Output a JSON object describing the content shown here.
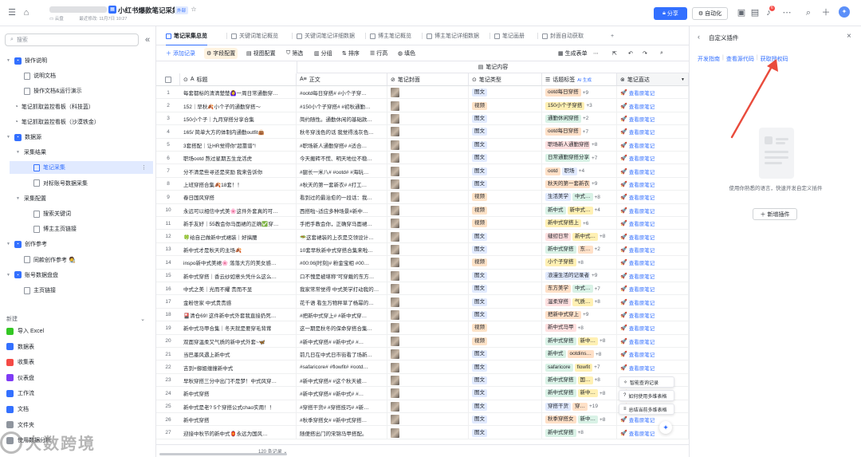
{
  "topbar": {
    "title": "小红书爆款笔记采集",
    "external_badge": "外部",
    "location": "云盘",
    "last_modified": "最近修改: 11月7日 10:27",
    "share_label": "分享",
    "automation_label": "自动化",
    "notification_count": "6"
  },
  "sidebar": {
    "search_placeholder": "搜索",
    "tree": [
      {
        "label": "操作说明",
        "level": 0,
        "kind": "folder",
        "color": "#3370ff",
        "expanded": true
      },
      {
        "label": "说明文档",
        "level": 1,
        "kind": "doc"
      },
      {
        "label": "操作文档&运行演示",
        "level": 1,
        "kind": "doc"
      },
      {
        "label": "笔记抓取监控看板（科技蓝）",
        "level": 0,
        "kind": "dash"
      },
      {
        "label": "笔记抓取监控看板（沙漠铁金）",
        "level": 0,
        "kind": "dash"
      },
      {
        "label": "数据源",
        "level": 0,
        "kind": "folder",
        "color": "#3370ff",
        "expanded": true
      },
      {
        "label": "采集结果",
        "level": 1,
        "kind": "group",
        "expanded": true
      },
      {
        "label": "笔记采集",
        "level": 2,
        "kind": "grid",
        "selected": true
      },
      {
        "label": "对标账号数据采集",
        "level": 2,
        "kind": "grid"
      },
      {
        "label": "采集配置",
        "level": 1,
        "kind": "group",
        "expanded": true
      },
      {
        "label": "搜索关键词",
        "level": 2,
        "kind": "grid"
      },
      {
        "label": "博主主页链接",
        "level": 2,
        "kind": "grid"
      },
      {
        "label": "创作参考",
        "level": 0,
        "kind": "folder",
        "color": "#3370ff",
        "expanded": true
      },
      {
        "label": "同款创作参考 🧑‍🎨",
        "level": 1,
        "kind": "doc"
      },
      {
        "label": "账号数据盘盘",
        "level": 0,
        "kind": "folder",
        "color": "#3370ff",
        "expanded": true
      },
      {
        "label": "主页链接",
        "level": 1,
        "kind": "doc"
      }
    ],
    "new_heading": "新建",
    "new_items": [
      {
        "label": "导入 Excel",
        "color": "#34c724"
      },
      {
        "label": "数据表",
        "color": "#3370ff"
      },
      {
        "label": "收集表",
        "color": "#f54a45"
      },
      {
        "label": "仪表盘",
        "color": "#7f3bf5"
      },
      {
        "label": "工作流",
        "color": "#3370ff"
      },
      {
        "label": "文档",
        "color": "#3370ff"
      },
      {
        "label": "文件夹",
        "color": "#8f959e"
      },
      {
        "label": "使用数据分析",
        "color": "#8f959e"
      }
    ]
  },
  "tabs": [
    "笔记采集总览",
    "关键词笔记概览",
    "关键词笔记详细数据",
    "博主笔记概览",
    "博主笔记详细数据",
    "笔记画册",
    "封面自动获取"
  ],
  "toolbar": {
    "add": "添加记录",
    "field_config": "字段配置",
    "view_config": "视图配置",
    "filter": "筛选",
    "group": "分组",
    "sort": "排序",
    "row_height": "行高",
    "fill": "填色",
    "gen_form": "生成表单"
  },
  "grid": {
    "group_header": "笔记内容",
    "columns": {
      "title": "标题",
      "body": "正文",
      "cover": "笔记封面",
      "type": "笔记类型",
      "tags": "话题标签",
      "tags_ai": "AI 生成",
      "link": "笔记直达"
    },
    "link_text": "查看原笔记",
    "rows": [
      {
        "n": "1",
        "title": "每套都标的清清楚楚🙆‍♀️一周日常通勤穿…",
        "body": "#ootd每日穿搭# #小个子穿…",
        "type": "图文",
        "tags": [
          {
            "t": "ootd每日穿搭",
            "c": "#ffe0c7"
          }
        ],
        "more": "+9"
      },
      {
        "n": "2",
        "title": "152｜早秋🍂小个子的通勤穿搭～",
        "body": "#150小个子穿搭# #初秋通勤…",
        "type": "视频",
        "tags": [
          {
            "t": "150小个子穿搭",
            "c": "#fff0b3"
          }
        ],
        "more": "+3"
      },
      {
        "n": "3",
        "title": "150小个子｜九月穿搭分享合集",
        "body": "简约随性。通勤休闲的基础款…",
        "type": "图文",
        "tags": [
          {
            "t": "通勤休闲穿搭",
            "c": "#d9f2e6"
          }
        ],
        "more": "+2"
      },
      {
        "n": "4",
        "title": "165/ 简单大方的体制内通勤outfit👜",
        "body": "秋冬穿浅色的话 我觉得浅灰色…",
        "type": "图文",
        "tags": [
          {
            "t": "ootd每日穿搭",
            "c": "#ffe0c7"
          }
        ],
        "more": "+7"
      },
      {
        "n": "5",
        "title": "3套搭配｜让HR觉得你\"超靠谱\"!",
        "body": "#职场新人通勤穿搭# #适合…",
        "type": "图文",
        "tags": [
          {
            "t": "职场新人通勤穿搭",
            "c": "#ffe0e0"
          }
        ],
        "more": "+8"
      },
      {
        "n": "6",
        "title": "职场ootd 熬过星期五生龙活虎",
        "body": "今天搬砖不慌、明天地位不稳…",
        "type": "图文",
        "tags": [
          {
            "t": "日常通勤穿搭分享",
            "c": "#d9f2e6"
          }
        ],
        "more": "+7"
      },
      {
        "n": "7",
        "title": "分不清是些寻还是奖励 我来告诉你",
        "body": "#腿长一米八# #ootd# #海玩…",
        "type": "图文",
        "tags": [
          {
            "t": "ootd",
            "c": "#ffe0c7"
          },
          {
            "t": "职场",
            "c": "#e1eaff"
          }
        ],
        "more": "+4"
      },
      {
        "n": "8",
        "title": "上班穿搭合集🍂18套！！",
        "body": "#秋天的第一套新衣# #打工…",
        "type": "图文",
        "tags": [
          {
            "t": "秋天的第一套新衣",
            "c": "#ffe0c7"
          }
        ],
        "more": "+9"
      },
      {
        "n": "9",
        "title": "春日国风穿搭",
        "body": "看到过的最治愈的一段话：我…",
        "type": "视频",
        "tags": [
          {
            "t": "生活美学",
            "c": "#e1eaff"
          },
          {
            "t": "中式…",
            "c": "#d9f2e6"
          }
        ],
        "more": "+8"
      },
      {
        "n": "10",
        "title": "永远可以相信中式美🌸这件外套真的可…",
        "body": "西搭啦~适应多种场景#新中…",
        "type": "视频",
        "tags": [
          {
            "t": "新中式",
            "c": "#d9f2e6"
          },
          {
            "t": "新中式…",
            "c": "#fff0b3"
          }
        ],
        "more": "+4"
      },
      {
        "n": "11",
        "title": "新手友好｜55教会你马面裙的正确✅穿…",
        "body": "手把手教会你，正确穿马面裙…",
        "type": "视频",
        "tags": [
          {
            "t": "新中式穿搭上",
            "c": "#fff0b3"
          }
        ],
        "more": "+6"
      },
      {
        "n": "12",
        "title": "🍀给自己做新中式裙装｜好搞腰",
        "body": "🥗这套裙装的上衣是交领设计…",
        "type": "图文",
        "tags": [
          {
            "t": "缝纫日常",
            "c": "#ffe0e0"
          },
          {
            "t": "新中式…",
            "c": "#fff0b3"
          }
        ],
        "more": "+8"
      },
      {
        "n": "13",
        "title": "新中式才是秋天的主场🍂",
        "body": "10套早秋新中式穿搭合集来啦…",
        "type": "图文",
        "tags": [
          {
            "t": "新中式穿搭",
            "c": "#d9f2e6"
          },
          {
            "t": "东…",
            "c": "#ffe0c7"
          }
        ],
        "more": "+2"
      },
      {
        "n": "14",
        "title": "inspo新中式美裙🌸 落落大方的美女感…",
        "body": "#00:06[时刻]# 粉金宝相 #00…",
        "type": "视频",
        "tags": [
          {
            "t": "小个子穿搭",
            "c": "#fff0b3"
          }
        ],
        "more": "+8"
      },
      {
        "n": "15",
        "title": "新中式穿搭｜香云纱如意头凭什么这么…",
        "body": "口不愧是被堪称\"可穿戴的东方…",
        "type": "图文",
        "tags": [
          {
            "t": "浪漫生活的记录者",
            "c": "#e1eaff"
          }
        ],
        "more": "+9"
      },
      {
        "n": "16",
        "title": "中式之美｜光而不耀 贵而不显",
        "body": "我家常常觉得 中式美学打动我的…",
        "type": "图文",
        "tags": [
          {
            "t": "东方美学",
            "c": "#ffe0c7"
          },
          {
            "t": "中式…",
            "c": "#d9f2e6"
          }
        ],
        "more": "+7"
      },
      {
        "n": "17",
        "title": "金粉世家 中式贵贵感",
        "body": "花千语 看生万物秤草了杨幂的…",
        "type": "图文",
        "tags": [
          {
            "t": "温柔穿搭",
            "c": "#ffe0e0"
          },
          {
            "t": "气质…",
            "c": "#fff0b3"
          }
        ],
        "more": "+8"
      },
      {
        "n": "18",
        "title": "🎴清仓69! 这件新中式外套我直接扔死…",
        "body": "#把新中式穿上# #新中式穿…",
        "type": "图文",
        "tags": [
          {
            "t": "把新中式穿上",
            "c": "#ffe0c7"
          }
        ],
        "more": "+9"
      },
      {
        "n": "19",
        "title": "新中式马甲合集｜冬天就是要穿毛背茸",
        "body": "这一期是秋冬的保命穿搭合集…",
        "type": "视频",
        "tags": [
          {
            "t": "新中式马甲",
            "c": "#ffe0e0"
          }
        ],
        "more": "+8"
      },
      {
        "n": "20",
        "title": "双面穿温柔又气质的新中式外套~🦋",
        "body": "#新中式穿搭# #新中式# #…",
        "type": "视频",
        "tags": [
          {
            "t": "新中式穿搭",
            "c": "#d9f2e6"
          },
          {
            "t": "新中…",
            "c": "#fff0b3"
          }
        ],
        "more": "+8"
      },
      {
        "n": "21",
        "title": "当巴墨风遇上新中式",
        "body": "前几日在中式日市街看了场新…",
        "type": "图文",
        "tags": [
          {
            "t": "新中式",
            "c": "#d9f2e6"
          },
          {
            "t": "ootdins…",
            "c": "#ffe0c7"
          }
        ],
        "more": "+8"
      },
      {
        "n": "22",
        "title": "吉到+御姐缠撞新中式",
        "body": "#safaricore# #flowfit# #ootd…",
        "type": "图文",
        "tags": [
          {
            "t": "safaricore",
            "c": "#d9f2e6"
          },
          {
            "t": "flowfit",
            "c": "#fff0b3"
          }
        ],
        "more": "+7"
      },
      {
        "n": "23",
        "title": "早秋穿搭三分中出门不是梦！中式风穿…",
        "body": "#新中式穿搭# #这个秋天被…",
        "type": "图文",
        "tags": [
          {
            "t": "新中式穿搭",
            "c": "#d9f2e6"
          },
          {
            "t": "国…",
            "c": "#fff0b3"
          }
        ],
        "more": "+8"
      },
      {
        "n": "24",
        "title": "新中式穿搭",
        "body": "#新中式穿搭# #新中式# #…",
        "type": "图文",
        "tags": [
          {
            "t": "新中式穿搭",
            "c": "#d9f2e6"
          },
          {
            "t": "新中…",
            "c": "#fff0b3"
          }
        ],
        "more": "+8"
      },
      {
        "n": "25",
        "title": "新中式是老? 5个穿搭公式chao实用！！",
        "body": "#穿搭干货# #穿搭技巧# #新…",
        "type": "图文",
        "tags": [
          {
            "t": "穿搭干货",
            "c": "#e1eaff"
          },
          {
            "t": "穿…",
            "c": "#ffe0c7"
          }
        ],
        "more": "+19"
      },
      {
        "n": "26",
        "title": "新中式穿搭",
        "body": "#秋季穿搭女# #新中式穿搭…",
        "type": "图文",
        "tags": [
          {
            "t": "秋季穿搭女",
            "c": "#ffe0c7"
          },
          {
            "t": "新中…",
            "c": "#d9f2e6"
          }
        ],
        "more": "+8"
      },
      {
        "n": "27",
        "title": "迎接中秋节的新中式🏮永远为国风…",
        "body": "随便搭出门的宋锦马甲搭配。",
        "type": "图文",
        "tags": [
          {
            "t": "新中式穿搭",
            "c": "#d9f2e6"
          }
        ],
        "more": "+8"
      }
    ],
    "record_count": "120 条记录"
  },
  "right_panel": {
    "title": "自定义插件",
    "links": [
      "开发指南",
      "查看源代码",
      "获取授权码"
    ],
    "description": "使用你熟悉的语言，快速开发自定义插件",
    "add_label": "新增插件"
  },
  "floating_menu": [
    "智能查询记录",
    "如何使用多维表格",
    "总结当前多维表格"
  ],
  "watermark": "大数跨境",
  "colors": {
    "accent": "#3370ff",
    "arrow": "#e94b3c"
  }
}
